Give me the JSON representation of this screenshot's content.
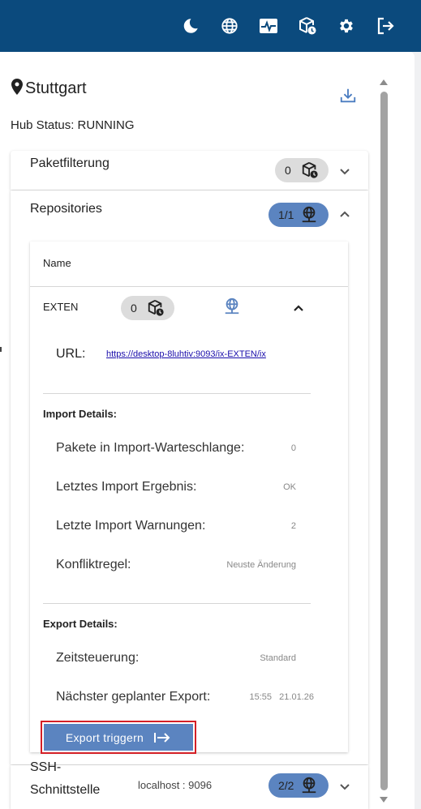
{
  "topbar": {
    "icons": [
      "moon-icon",
      "globe-icon",
      "activity-icon",
      "package-clock-icon",
      "gear-icon",
      "logout-icon"
    ]
  },
  "header": {
    "location": "Stuttgart",
    "hub_status": "Hub Status: RUNNING"
  },
  "accordion": {
    "paketfilterung": {
      "title": "Paketfilterung",
      "count": "0"
    },
    "repositories": {
      "title": "Repositories",
      "count": "1/1"
    },
    "ssh": {
      "title_line1": "SSH-",
      "title_line2": "Schnittstelle",
      "host": "localhost : 9096",
      "count": "2/2"
    }
  },
  "repo_table": {
    "column_name": "Name",
    "row": {
      "name": "EXTEN",
      "package_count": "0",
      "url_label": "URL:",
      "url": "https://desktop-8luhtiv:9093/ix-EXTEN/ix"
    }
  },
  "import_details": {
    "title": "Import Details:",
    "rows": [
      {
        "label": "Pakete in Import-Warteschlange:",
        "value": "0"
      },
      {
        "label": "Letztes Import Ergebnis:",
        "value": "OK"
      },
      {
        "label": "Letzte Import Warnungen:",
        "value": "2"
      },
      {
        "label": "Konfliktregel:",
        "value": "Neuste Änderung"
      }
    ]
  },
  "export_details": {
    "title": "Export Details:",
    "rows": [
      {
        "label": "Zeitsteuerung:",
        "value": "Standard"
      },
      {
        "label": "Nächster geplanter Export:",
        "value": "15:55   21.01.26"
      }
    ]
  },
  "export_button": {
    "label": "Export triggern"
  },
  "colors": {
    "topbar": "#0b4a7d",
    "accent": "#5b84c0",
    "highlight": "#d41f26"
  }
}
